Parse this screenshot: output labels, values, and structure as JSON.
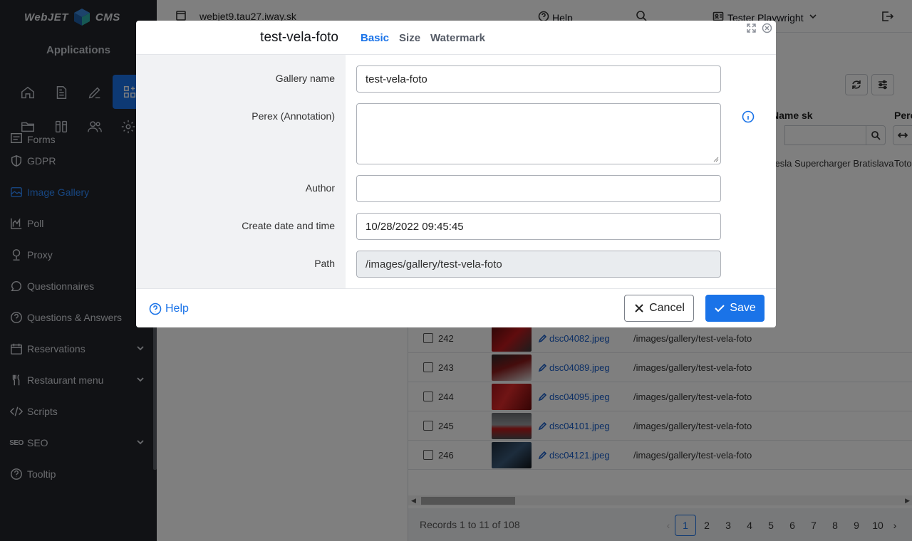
{
  "brand": {
    "left": "WebJET",
    "right": "CMS"
  },
  "sidebar": {
    "title": "Applications",
    "items": [
      {
        "label": "Forms",
        "icon": "forms-icon"
      },
      {
        "label": "GDPR",
        "icon": "shield-icon"
      },
      {
        "label": "Image Gallery",
        "icon": "image-icon",
        "active": true
      },
      {
        "label": "Poll",
        "icon": "chart-icon"
      },
      {
        "label": "Proxy",
        "icon": "proxy-icon"
      },
      {
        "label": "Questionnaires",
        "icon": "chat-icon"
      },
      {
        "label": "Questions & Answers",
        "icon": "question-icon"
      },
      {
        "label": "Reservations",
        "icon": "calendar-icon",
        "expandable": true
      },
      {
        "label": "Restaurant menu",
        "icon": "fork-knife-icon",
        "expandable": true
      },
      {
        "label": "Scripts",
        "icon": "code-icon"
      },
      {
        "label": "SEO",
        "icon": "seo-icon",
        "expandable": true
      },
      {
        "label": "Tooltip",
        "icon": "question-icon"
      }
    ],
    "seo_icon_text": "SEO"
  },
  "topbar": {
    "host": "webjet9.tau27.iway.sk",
    "help": "Help",
    "user": "Tester Playwright"
  },
  "table": {
    "col_name_sk": "Name sk",
    "col_perex": "Pere",
    "first_row_name": "Tesla Supercharger Bratislava",
    "first_row_perex": "Toto",
    "rows": [
      {
        "id": "242",
        "file": "dsc04082.jpeg",
        "path": "/images/gallery/test-vela-foto"
      },
      {
        "id": "243",
        "file": "dsc04089.jpeg",
        "path": "/images/gallery/test-vela-foto"
      },
      {
        "id": "244",
        "file": "dsc04095.jpeg",
        "path": "/images/gallery/test-vela-foto"
      },
      {
        "id": "245",
        "file": "dsc04101.jpeg",
        "path": "/images/gallery/test-vela-foto"
      },
      {
        "id": "246",
        "file": "dsc04121.jpeg",
        "path": "/images/gallery/test-vela-foto"
      }
    ],
    "records": "Records 1 to 11 of 108",
    "pages": [
      "1",
      "2",
      "3",
      "4",
      "5",
      "6",
      "7",
      "8",
      "9",
      "10"
    ],
    "current_page": "1"
  },
  "modal": {
    "title": "test-vela-foto",
    "tabs": [
      "Basic",
      "Size",
      "Watermark"
    ],
    "active_tab": "Basic",
    "fields": {
      "gallery_name_label": "Gallery name",
      "gallery_name_value": "test-vela-foto",
      "perex_label": "Perex (Annotation)",
      "perex_value": "",
      "author_label": "Author",
      "author_value": "",
      "date_label": "Create date and time",
      "date_value": "10/28/2022 09:45:45",
      "path_label": "Path",
      "path_value": "/images/gallery/test-vela-foto"
    },
    "help": "Help",
    "cancel": "Cancel",
    "save": "Save"
  },
  "colors": {
    "accent": "#1a73e8",
    "sidebar_bg": "#22252b",
    "overlay": "rgba(0,0,0,0.5)"
  }
}
